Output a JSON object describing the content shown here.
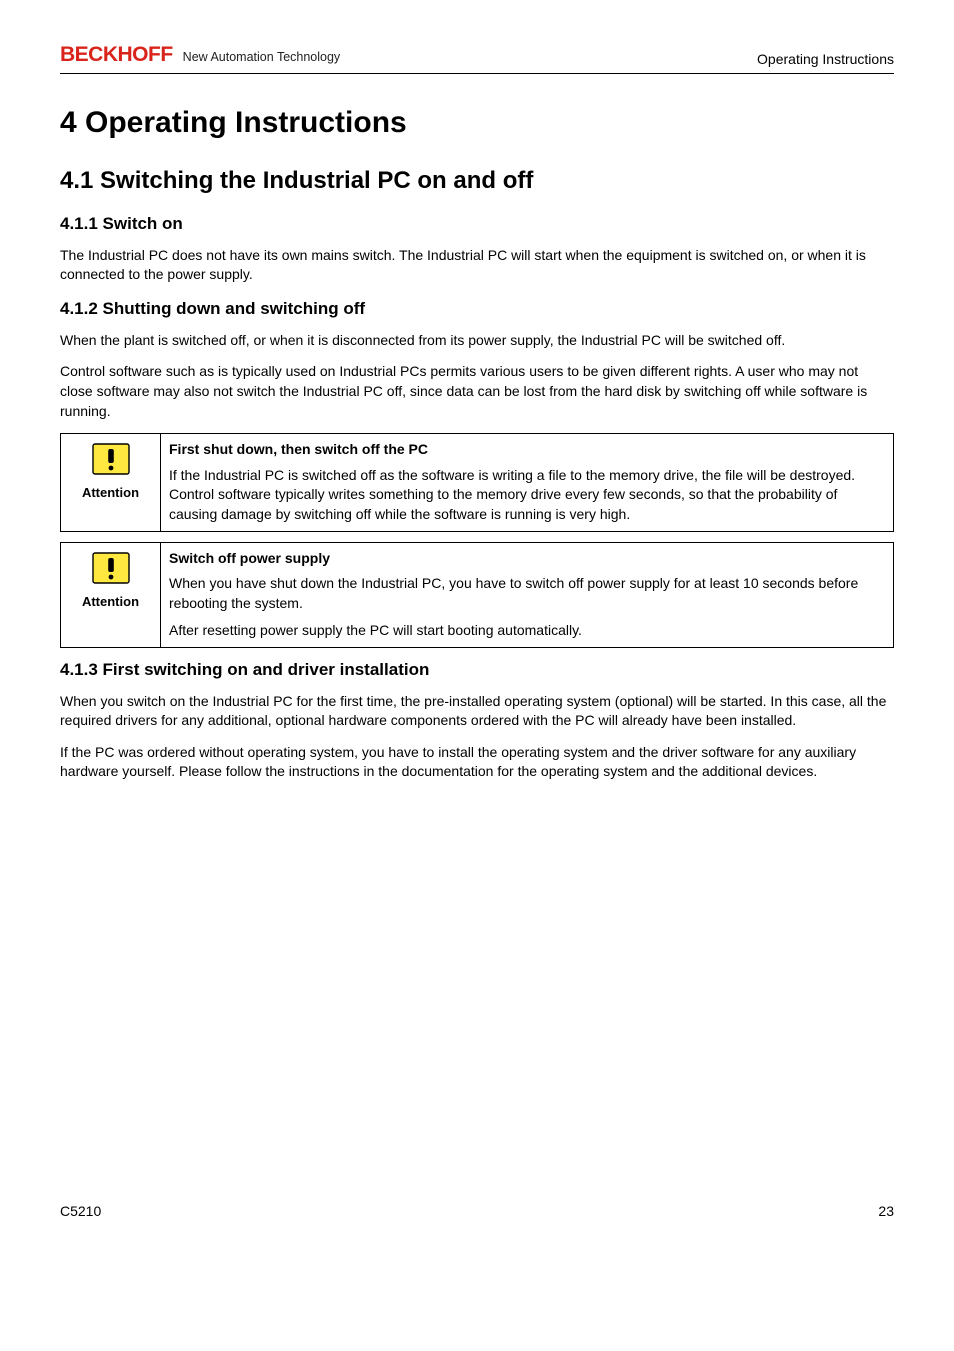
{
  "header": {
    "brand": "BECKHOFF",
    "tagline": "New Automation Technology",
    "section_title": "Operating Instructions"
  },
  "h1": "4  Operating Instructions",
  "h2": "4.1  Switching the Industrial PC on and off",
  "sec_switch_on": {
    "heading": "4.1.1  Switch on",
    "p1": "The Industrial PC does not have its own mains switch. The Industrial PC will start when the equipment is switched on, or when it is connected to the power supply."
  },
  "sec_shutdown": {
    "heading": "4.1.2  Shutting down and switching off",
    "p1": "When the plant is switched off, or when it is disconnected from its power supply, the Industrial PC will be switched off.",
    "p2": "Control software such as is typically used on Industrial PCs permits various users to be given different rights. A user who may not close software may also not switch the Industrial PC off, since data can be lost from the hard disk by switching off while software is running."
  },
  "notice1": {
    "label": "Attention",
    "title": "First shut down, then switch off the PC",
    "body": "If the Industrial PC is switched off as the software is writing a file to the memory drive, the file will be destroyed. Control software typically writes something to the memory drive every few seconds, so that the probability of causing damage by switching off while the software is running is very high."
  },
  "notice2": {
    "label": "Attention",
    "title": "Switch off power supply",
    "body1": "When you have shut down the Industrial PC, you have to switch off power supply for at least 10 seconds before rebooting the system.",
    "body2": "After resetting power supply the PC will start booting automatically."
  },
  "sec_first_switch": {
    "heading": "4.1.3  First switching on and driver installation",
    "p1": "When you switch on the Industrial PC for the first time, the pre-installed operating system (optional) will be started. In this case, all the required drivers for any additional, optional hardware components ordered with the PC will already have been installed.",
    "p2": "If the PC was ordered without operating system, you have to install the operating system and the driver software for any auxiliary hardware yourself. Please follow the instructions in the documentation for the operating system and the additional devices."
  },
  "footer": {
    "left": "C5210",
    "right": "23"
  }
}
